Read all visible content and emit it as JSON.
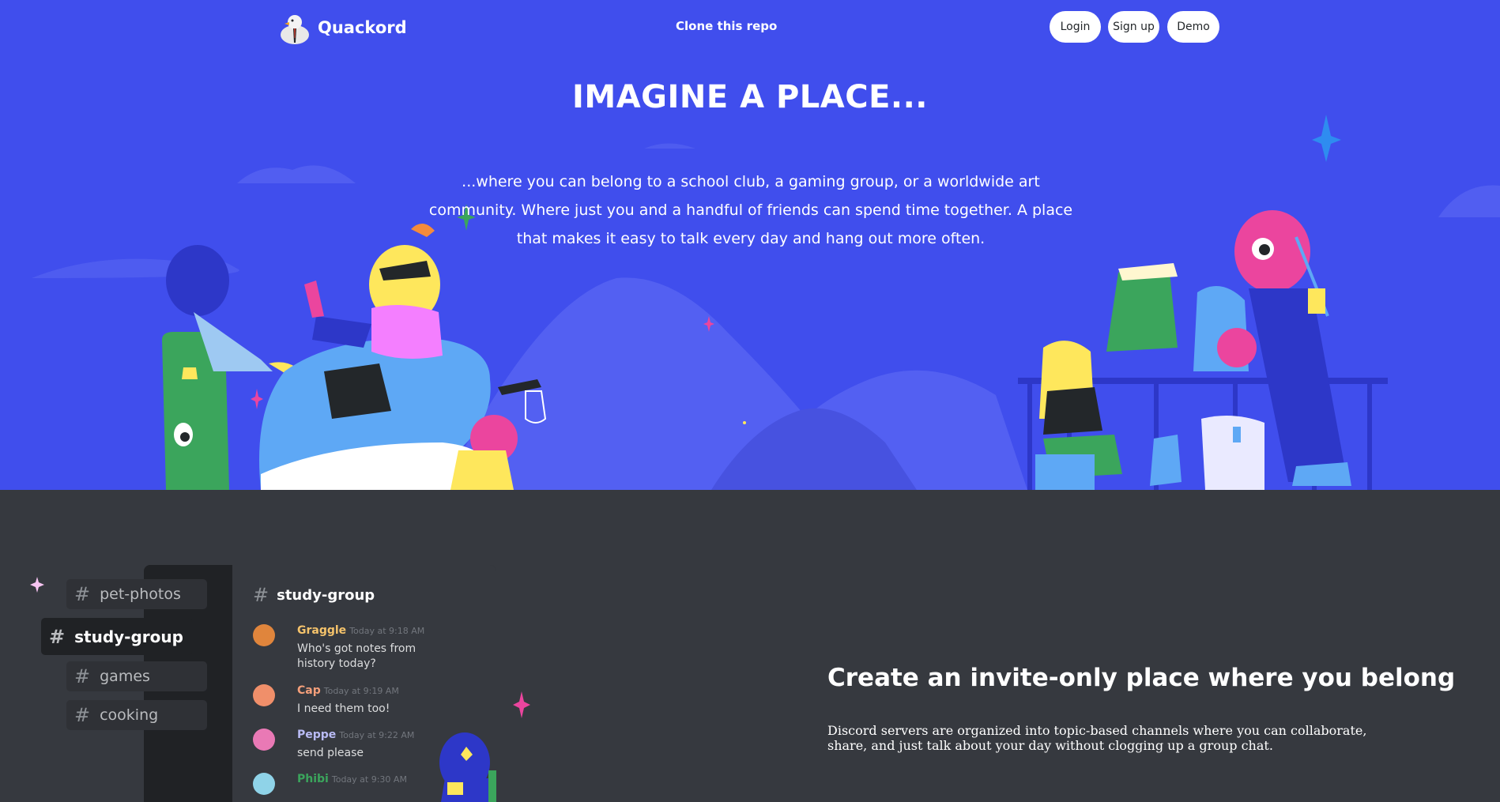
{
  "nav": {
    "brand": "Quackord",
    "center_link": "Clone this repo",
    "login": "Login",
    "signup": "Sign up",
    "demo": "Demo"
  },
  "hero": {
    "title": "IMAGINE A PLACE...",
    "subtitle": "...where you can belong to a school club, a gaming group, or a worldwide art community. Where just you and a handful of friends can spend time together. A place that makes it easy to talk every day and hang out more often."
  },
  "channels": [
    {
      "name": "pet-photos",
      "active": false
    },
    {
      "name": "study-group",
      "active": true
    },
    {
      "name": "games",
      "active": false
    },
    {
      "name": "cooking",
      "active": false
    }
  ],
  "chat": {
    "channel": "study-group",
    "messages": [
      {
        "user": "Graggle",
        "time": "Today at 9:18 AM",
        "text": "Who's got notes from history today?",
        "color": "#f5c36b",
        "avatar": "#e0853c"
      },
      {
        "user": "Cap",
        "time": "Today at 9:19 AM",
        "text": "I need them too!",
        "color": "#f49f7a",
        "avatar": "#f08f6a"
      },
      {
        "user": "Peppe",
        "time": "Today at 9:22 AM",
        "text": "send please",
        "color": "#b9bbf5",
        "avatar": "#e979b5"
      },
      {
        "user": "Phibi",
        "time": "Today at 9:30 AM",
        "text": "",
        "color": "#3ba55c",
        "avatar": "#8fd3e8"
      }
    ]
  },
  "feature": {
    "title": "Create an invite-only place where you belong",
    "text": "Discord servers are organized into topic-based channels where you can collaborate, share, and just talk about your day without clogging up a group chat."
  },
  "colors": {
    "hero_bg": "#404eed",
    "section_bg": "#36393f",
    "white": "#ffffff"
  }
}
